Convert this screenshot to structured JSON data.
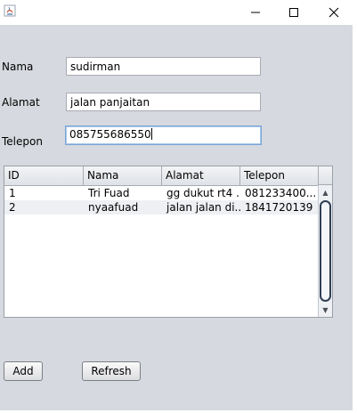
{
  "window": {
    "app_icon": "java-cup-icon",
    "minimize_symbol": "—",
    "close_symbol": "✕"
  },
  "form": {
    "nama_label": "Nama",
    "nama_value": "sudirman",
    "alamat_label": "Alamat",
    "alamat_value": "jalan panjaitan",
    "telepon_label": "Telepon",
    "telepon_value": "085755686550"
  },
  "table": {
    "columns": [
      "ID",
      "Nama",
      "Alamat",
      "Telepon"
    ],
    "rows": [
      [
        "1",
        "Tri Fuad",
        "gg dukut rt4 ...",
        "081233400..."
      ],
      [
        "2",
        "nyaafuad",
        "jalan jalan di...",
        "1841720139"
      ]
    ]
  },
  "buttons": {
    "add": "Add",
    "refresh": "Refresh"
  }
}
